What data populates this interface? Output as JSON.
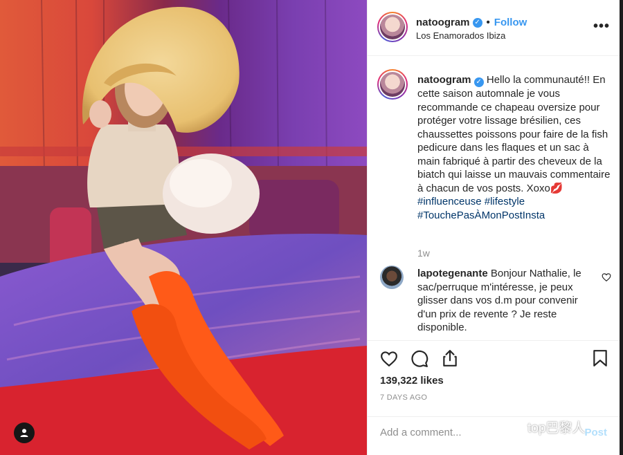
{
  "post": {
    "username": "natoogram",
    "follow_label": "Follow",
    "location": "Los Enamorados Ibiza",
    "more_label": "•••"
  },
  "caption": {
    "username": "natoogram",
    "text": "Hello la communauté!! En cette saison automnale je vous recommande ce chapeau oversize pour protéger votre lissage brésilien, ces chaussettes poissons pour faire de la fish pedicure dans les flaques et un sac à main fabriqué à partir des cheveux de la biatch qui laisse un mauvais commentaire à chacun de vos posts. Xoxo💋",
    "hashtags": [
      "#influenceuse",
      "#lifestyle",
      "#TouchePasÀMonPostInsta"
    ],
    "time": "1w"
  },
  "comment": {
    "username": "lapotegenante",
    "text": "Bonjour Nathalie, le sac/perruque m'intéresse, je peux glisser dans vos d.m pour convenir d'un prix de revente ? Je reste disponible."
  },
  "actions": {
    "likes": "139,322 likes",
    "time_ago": "7 DAYS AGO"
  },
  "add_comment": {
    "placeholder": "Add a comment...",
    "post_label": "Post"
  },
  "watermark": {
    "text": "top巴黎人"
  },
  "icons": [
    "verified-badge-icon",
    "more-options-icon",
    "heart-icon",
    "comment-icon",
    "share-icon",
    "bookmark-icon",
    "user-tag-icon",
    "small-heart-icon",
    "wechat-logo-icon"
  ],
  "colors": {
    "link_blue": "#3897f0",
    "hashtag": "#003569",
    "muted": "#8e8e8e",
    "post_disabled": "#b2dffc"
  }
}
